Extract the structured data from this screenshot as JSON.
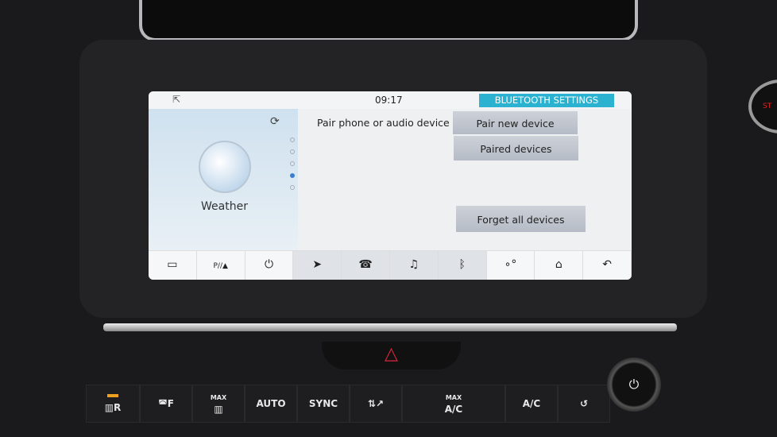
{
  "screen": {
    "time": "09:17",
    "title": "BLUETOOTH SETTINGS",
    "back_icon": "collapse-arrow-icon",
    "weather": {
      "label": "Weather",
      "refresh_icon": "refresh-icon"
    },
    "page_dots": {
      "count": 5,
      "active": 4
    },
    "section_label": "Pair phone or audio device",
    "buttons": {
      "pair_new": "Pair new device",
      "paired": "Paired devices",
      "forget_all": "Forget all devices"
    },
    "nav": [
      {
        "icon": "camera-icon",
        "glyph": "▭"
      },
      {
        "icon": "park-assist-icon",
        "glyph": "P//▲"
      },
      {
        "icon": "power-icon",
        "glyph": "⏻"
      },
      {
        "icon": "navigation-icon",
        "glyph": "➤"
      },
      {
        "icon": "phone-icon",
        "glyph": "☎"
      },
      {
        "icon": "media-icon",
        "glyph": "♫"
      },
      {
        "icon": "bluetooth-icon",
        "glyph": "ᛒ"
      },
      {
        "icon": "connected-apps-icon",
        "glyph": "∘°"
      },
      {
        "icon": "home-icon",
        "glyph": "⌂"
      },
      {
        "icon": "back-icon",
        "glyph": "↶"
      }
    ]
  },
  "hazard_glyph": "△",
  "climate": [
    {
      "label": "R",
      "sub": "",
      "icon": "rear-defrost-icon",
      "glyph": "▥",
      "led": "#f0a020"
    },
    {
      "label": "F",
      "sub": "",
      "icon": "front-defrost-icon",
      "glyph": "◚"
    },
    {
      "label": "",
      "sub": "MAX",
      "icon": "max-defrost-icon",
      "glyph": "▥"
    },
    {
      "label": "AUTO",
      "sub": ""
    },
    {
      "label": "SYNC",
      "sub": ""
    },
    {
      "label": "",
      "sub": "",
      "icon": "air-distribution-icon",
      "glyph": "⇅↗"
    },
    {
      "label": "A/C",
      "sub": "MAX"
    },
    {
      "label": "A/C",
      "sub": ""
    },
    {
      "label": "",
      "sub": "",
      "icon": "recirculation-icon",
      "glyph": "↺"
    }
  ],
  "knob_icon": "power-icon",
  "start_label": "ST"
}
